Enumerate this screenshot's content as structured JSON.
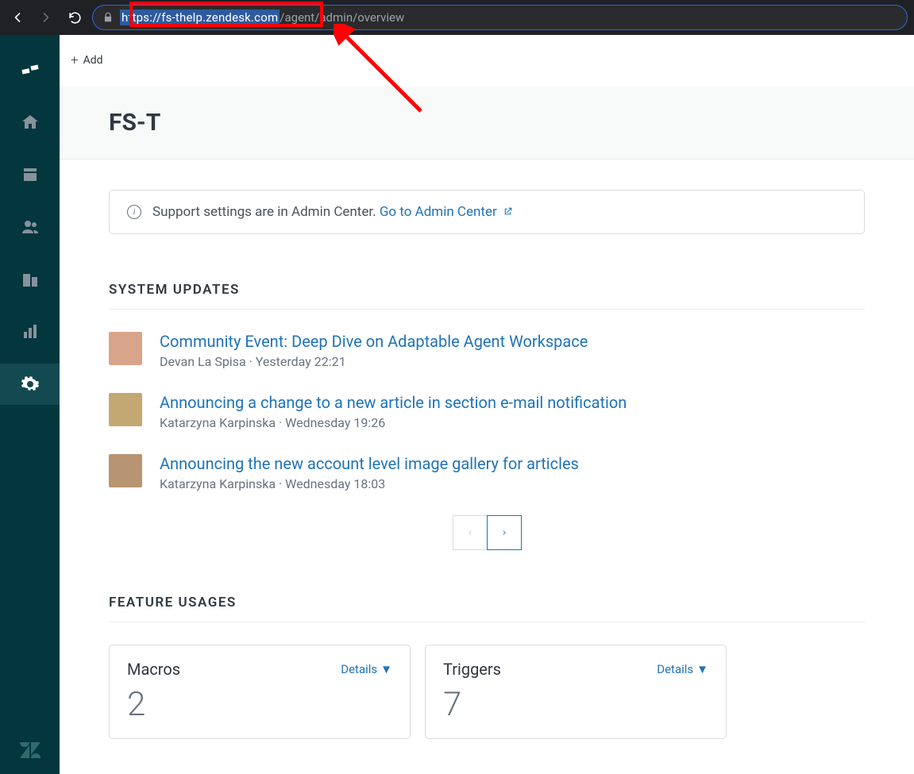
{
  "browser": {
    "url_highlighted": "https://fs-thelp.zendesk.com",
    "url_rest": "/agent/admin/overview"
  },
  "topbar": {
    "add_label": "Add"
  },
  "page": {
    "title": "FS-T"
  },
  "banner": {
    "text": "Support settings are in Admin Center. ",
    "link_label": "Go to Admin Center"
  },
  "sections": {
    "updates_heading": "SYSTEM UPDATES",
    "features_heading": "FEATURE USAGES"
  },
  "updates": [
    {
      "title": "Community Event: Deep Dive on Adaptable Agent Workspace",
      "meta": "Devan La Spisa · Yesterday 22:21"
    },
    {
      "title": "Announcing a change to a new article in section e-mail notification",
      "meta": "Katarzyna Karpinska · Wednesday 19:26"
    },
    {
      "title": "Announcing the new account level image gallery for articles",
      "meta": "Katarzyna Karpinska · Wednesday 18:03"
    }
  ],
  "features": {
    "details_label": "Details",
    "cards": [
      {
        "title": "Macros",
        "count": "2"
      },
      {
        "title": "Triggers",
        "count": "7"
      }
    ]
  }
}
